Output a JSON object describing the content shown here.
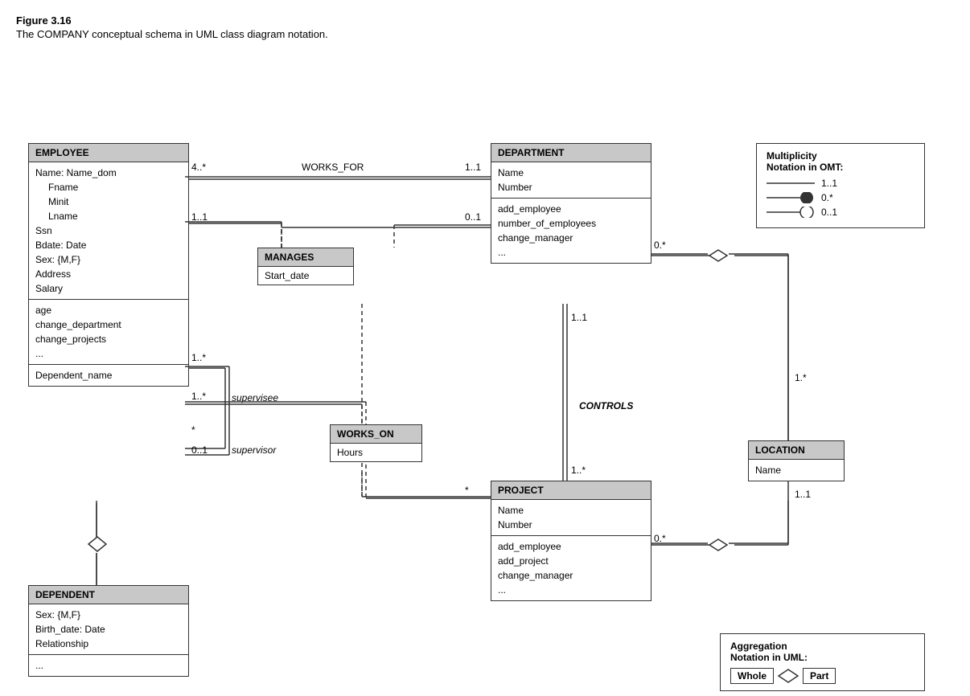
{
  "figure": {
    "title": "Figure 3.16",
    "caption": "The COMPANY conceptual schema in UML class diagram notation."
  },
  "classes": {
    "employee": {
      "header": "EMPLOYEE",
      "section1": [
        "Name: Name_dom",
        "   Fname",
        "   Minit",
        "   Lname",
        "Ssn",
        "Bdate: Date",
        "Sex: {M,F}",
        "Address",
        "Salary"
      ],
      "section2": [
        "age",
        "change_department",
        "change_projects",
        "..."
      ],
      "section3": [
        "Dependent_name"
      ]
    },
    "department": {
      "header": "DEPARTMENT",
      "section1": [
        "Name",
        "Number"
      ],
      "section2": [
        "add_employee",
        "number_of_employees",
        "change_manager",
        "..."
      ]
    },
    "project": {
      "header": "PROJECT",
      "section1": [
        "Name",
        "Number"
      ],
      "section2": [
        "add_employee",
        "add_project",
        "change_manager",
        "..."
      ]
    },
    "dependent": {
      "header": "DEPENDENT",
      "section1": [
        "Sex: {M,F}",
        "Birth_date: Date",
        "Relationship"
      ],
      "section2": [
        "..."
      ]
    },
    "location": {
      "header": "LOCATION",
      "section1": [
        "Name"
      ]
    }
  },
  "associations": {
    "manages": {
      "header": "MANAGES",
      "body": "Start_date"
    },
    "works_on": {
      "header": "WORKS_ON",
      "body": "Hours"
    }
  },
  "relationships": {
    "works_for": "WORKS_FOR",
    "controls": "CONTROLS"
  },
  "multiplicities": {
    "works_for_emp": "4..*",
    "works_for_dept": "1..1",
    "manages_emp": "1..1",
    "manages_dept": "0..1",
    "supervises_sup": "1..*",
    "supervises_sub": "*",
    "supervisee_label": "supervisee",
    "supervisor_label": "0..1",
    "supervisor_role": "supervisor",
    "works_on_emp": "1..*",
    "works_on_proj": "*",
    "controls_dept": "1..1",
    "controls_proj": "1..*",
    "dept_location": "0.*",
    "location_dept": "1.*",
    "location_loc": "1..1",
    "proj_location": "0.*"
  },
  "notation": {
    "title1": "Multiplicity",
    "title2": "Notation in OMT:",
    "rows": [
      {
        "label": "1..1"
      },
      {
        "label": "0.*"
      },
      {
        "label": "0..1"
      }
    ]
  },
  "aggregation": {
    "title1": "Aggregation",
    "title2": "Notation in UML:",
    "whole": "Whole",
    "part": "Part"
  }
}
